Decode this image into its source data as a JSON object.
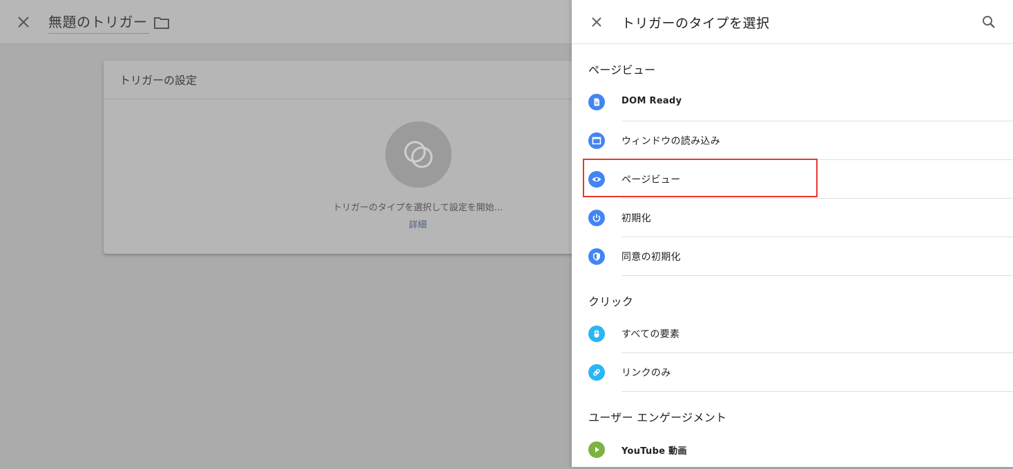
{
  "background": {
    "header": {
      "title": "無題のトリガー",
      "close_icon": "close-icon",
      "folder_icon": "folder-icon"
    },
    "card": {
      "title": "トリガーの設定",
      "placeholder_icon": "trigger-placeholder-icon",
      "hint": "トリガーのタイプを選択して設定を開始...",
      "link": "詳細"
    }
  },
  "panel": {
    "title": "トリガーのタイプを選択",
    "close_icon": "close-icon",
    "search_icon": "search-icon",
    "sections": [
      {
        "label": "ページビュー",
        "items": [
          {
            "label": "DOM Ready",
            "icon": "document-icon",
            "color": "#4285f4",
            "bold": true
          },
          {
            "label": "ウィンドウの読み込み",
            "icon": "window-icon",
            "color": "#4285f4",
            "bold": false
          },
          {
            "label": "ページビュー",
            "icon": "eye-icon",
            "color": "#4285f4",
            "bold": false,
            "highlighted": true
          },
          {
            "label": "初期化",
            "icon": "power-icon",
            "color": "#4285f4",
            "bold": false
          },
          {
            "label": "同意の初期化",
            "icon": "shield-icon",
            "color": "#4285f4",
            "bold": false
          }
        ]
      },
      {
        "label": "クリック",
        "items": [
          {
            "label": "すべての要素",
            "icon": "mouse-icon",
            "color": "#29b6f6",
            "bold": false
          },
          {
            "label": "リンクのみ",
            "icon": "link-icon",
            "color": "#29b6f6",
            "bold": false
          }
        ]
      },
      {
        "label": "ユーザー エンゲージメント",
        "items": [
          {
            "label": "YouTube 動画",
            "icon": "play-icon",
            "color": "#7cb342",
            "bold": true
          }
        ]
      }
    ]
  },
  "colors": {
    "highlight_border": "#e8372b",
    "page_view_blue": "#4285f4",
    "click_cyan": "#29b6f6",
    "engagement_green": "#7cb342"
  }
}
